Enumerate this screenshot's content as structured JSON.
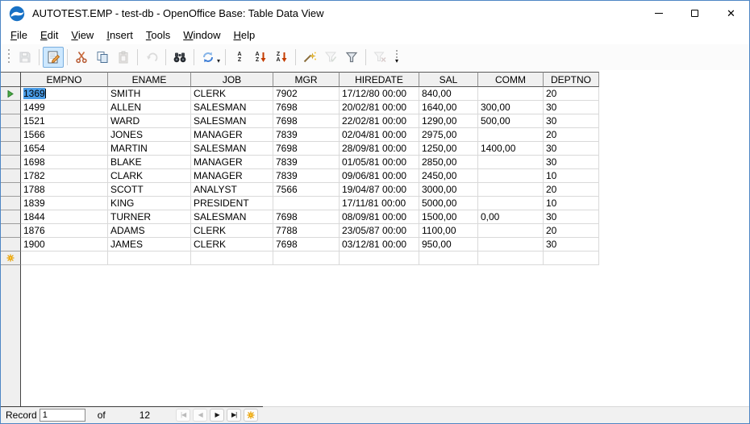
{
  "window": {
    "title": "AUTOTEST.EMP - test-db - OpenOffice Base: Table Data View",
    "controls": [
      "minimize",
      "maximize",
      "close"
    ]
  },
  "menu": {
    "items": [
      "File",
      "Edit",
      "View",
      "Insert",
      "Tools",
      "Window",
      "Help"
    ]
  },
  "toolbar": {
    "buttons": [
      {
        "name": "save",
        "icon": "save-icon",
        "disabled": true,
        "sep_after": true
      },
      {
        "name": "edit-data",
        "icon": "edit-data-icon",
        "active": true,
        "sep_after": true
      },
      {
        "name": "cut",
        "icon": "scissors-icon"
      },
      {
        "name": "copy",
        "icon": "copy-icon"
      },
      {
        "name": "paste",
        "icon": "paste-icon",
        "disabled": true,
        "sep_after": true
      },
      {
        "name": "undo",
        "icon": "undo-icon",
        "disabled": true,
        "sep_after": true
      },
      {
        "name": "find-record",
        "icon": "binoculars-icon",
        "sep_after": true
      },
      {
        "name": "refresh",
        "icon": "refresh-icon",
        "has_dropdown": true,
        "sep_after": true
      },
      {
        "name": "sort",
        "icon": "sort-az-icon"
      },
      {
        "name": "sort-ascending",
        "icon": "sort-ascending-icon"
      },
      {
        "name": "sort-descending",
        "icon": "sort-descending-icon",
        "sep_after": true
      },
      {
        "name": "auto-filter",
        "icon": "magic-wand-icon"
      },
      {
        "name": "apply-filter",
        "icon": "funnel-check-icon",
        "disabled": true
      },
      {
        "name": "standard-filter",
        "icon": "funnel-icon",
        "sep_after": true
      },
      {
        "name": "remove-filter",
        "icon": "funnel-x-icon",
        "disabled": true
      }
    ]
  },
  "table": {
    "columns": [
      "EMPNO",
      "ENAME",
      "JOB",
      "MGR",
      "HIREDATE",
      "SAL",
      "COMM",
      "DEPTNO"
    ],
    "rows": [
      [
        "1369",
        "SMITH",
        "CLERK",
        "7902",
        "17/12/80 00:00",
        "840,00",
        "",
        "20"
      ],
      [
        "1499",
        "ALLEN",
        "SALESMAN",
        "7698",
        "20/02/81 00:00",
        "1640,00",
        "300,00",
        "30"
      ],
      [
        "1521",
        "WARD",
        "SALESMAN",
        "7698",
        "22/02/81 00:00",
        "1290,00",
        "500,00",
        "30"
      ],
      [
        "1566",
        "JONES",
        "MANAGER",
        "7839",
        "02/04/81 00:00",
        "2975,00",
        "",
        "20"
      ],
      [
        "1654",
        "MARTIN",
        "SALESMAN",
        "7698",
        "28/09/81 00:00",
        "1250,00",
        "1400,00",
        "30"
      ],
      [
        "1698",
        "BLAKE",
        "MANAGER",
        "7839",
        "01/05/81 00:00",
        "2850,00",
        "",
        "30"
      ],
      [
        "1782",
        "CLARK",
        "MANAGER",
        "7839",
        "09/06/81 00:00",
        "2450,00",
        "",
        "10"
      ],
      [
        "1788",
        "SCOTT",
        "ANALYST",
        "7566",
        "19/04/87 00:00",
        "3000,00",
        "",
        "20"
      ],
      [
        "1839",
        "KING",
        "PRESIDENT",
        "",
        "17/11/81 00:00",
        "5000,00",
        "",
        "10"
      ],
      [
        "1844",
        "TURNER",
        "SALESMAN",
        "7698",
        "08/09/81 00:00",
        "1500,00",
        "0,00",
        "30"
      ],
      [
        "1876",
        "ADAMS",
        "CLERK",
        "7788",
        "23/05/87 00:00",
        "1100,00",
        "",
        "20"
      ],
      [
        "1900",
        "JAMES",
        "CLERK",
        "7698",
        "03/12/81 00:00",
        "950,00",
        "",
        "30"
      ]
    ],
    "selection": {
      "row_index": 0,
      "column": "EMPNO",
      "value": "1369"
    },
    "current_row_marker_icon": "current-row-triangle-icon",
    "insert_row_icon": "new-record-star-icon"
  },
  "record_bar": {
    "label": "Record",
    "current": "1",
    "of_label": "of",
    "total": "12",
    "nav": [
      {
        "name": "first-record",
        "disabled": true
      },
      {
        "name": "previous-record",
        "disabled": true
      },
      {
        "name": "next-record",
        "disabled": false
      },
      {
        "name": "last-record",
        "disabled": false
      },
      {
        "name": "new-record",
        "disabled": false
      }
    ]
  },
  "colors": {
    "selection_blue": "#4a9de8",
    "active_button_bg": "#cde8ff",
    "marker_green": "#49a942",
    "star_orange": "#e8a000"
  }
}
